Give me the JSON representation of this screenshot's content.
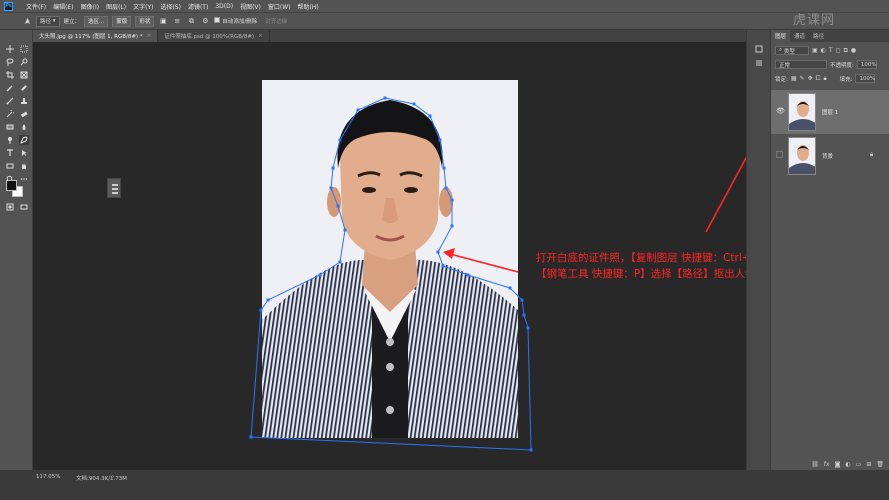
{
  "menubar": {
    "items": [
      "文件(F)",
      "编辑(E)",
      "图像(I)",
      "图层(L)",
      "文字(Y)",
      "选择(S)",
      "滤镜(T)",
      "3D(D)",
      "视图(V)",
      "窗口(W)",
      "帮助(H)"
    ]
  },
  "options_bar": {
    "mode_value": "路径",
    "make_label": "建立：",
    "selection_button": "选区...",
    "mask_button": "蒙版",
    "shape_button": "形状",
    "auto_add_delete_label": "自动添加/删除",
    "align_edges_label": "对齐边缘"
  },
  "doc_tabs": [
    {
      "label": "大头照.jpg @ 117% (图层 1, RGB/8#) *",
      "active": true
    },
    {
      "label": "证件照抽底.psd @ 100%(RGB/8#)",
      "active": false
    }
  ],
  "canvas": {
    "annotation_line1": "打开白底的证件照，【复制图层 快捷键：Ctrl+J】使用",
    "annotation_line2": "【钢笔工具 快捷键：P】选择【路径】抠出人物大致的轮廓",
    "annotation_color": "#ff2424",
    "path_color": "#2a73ff"
  },
  "watermark": "虎课网",
  "layers_panel": {
    "tabs": [
      "图层",
      "通道",
      "路径"
    ],
    "filter_kind": "类型",
    "blend_mode": "正常",
    "opacity_label": "不透明度:",
    "opacity_value": "100%",
    "lock_label": "锁定:",
    "fill_label": "填充:",
    "fill_value": "100%",
    "layers": [
      {
        "name": "图层 1",
        "visible": true,
        "selected": true
      },
      {
        "name": "背景",
        "visible": false,
        "selected": false,
        "locked": true
      }
    ]
  },
  "status": {
    "zoom": "117.05%",
    "doc_info": "文档:904.3K/1.73M"
  }
}
